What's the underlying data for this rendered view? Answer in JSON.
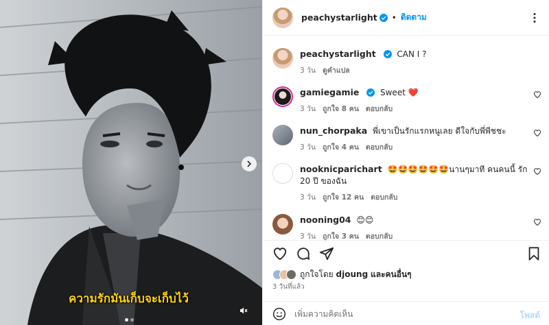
{
  "post": {
    "overlay_caption": "ความรักมันเก็บจะเก็บไว้",
    "carousel_dots": 2
  },
  "header": {
    "username": "peachystarlight",
    "separator": "•",
    "follow_label": "ติดตาม"
  },
  "caption": {
    "username": "peachystarlight",
    "text": "CAN I ?",
    "time": "3 วัน",
    "translate_label": "ดูคำแปล"
  },
  "comments": [
    {
      "username": "gamiegamie",
      "verified": true,
      "text": "Sweet ❤️",
      "time": "3 วัน",
      "likes": "ถูกใจ 8 คน",
      "reply": "ตอบกลับ"
    },
    {
      "username": "nun_chorpaka",
      "verified": false,
      "text": "พี่เขาเป็นรักแรกหนูเลย ดีใจกับพี่พีชชะ",
      "time": "3 วัน",
      "likes": "ถูกใจ 4 คน",
      "reply": "ตอบกลับ"
    },
    {
      "username": "nooknicparichart",
      "verified": false,
      "text": "🤩🤩🤩🤩🤩🤩นานๆมาที คนคนนี้ รัก 20 ปี ของฉัน",
      "time": "3 วัน",
      "likes": "ถูกใจ 12 คน",
      "reply": "ตอบกลับ"
    },
    {
      "username": "nooning04",
      "verified": false,
      "text": "😊😊",
      "time": "3 วัน",
      "likes": "ถูกใจ 3 คน",
      "reply": "ตอบกลับ"
    }
  ],
  "likes": {
    "prefix": "ถูกใจโดย",
    "user": "djoung",
    "suffix": "และคนอื่นๆ"
  },
  "timestamp": "3 วันที่แล้ว",
  "add_comment": {
    "placeholder": "เพิ่มความคิดเห็น",
    "post_label": "โพสต์"
  },
  "colors": {
    "accent": "#0095f6",
    "verified": "#0095f6",
    "overlay_text": "#ffd400",
    "heart_red": "#ed4956"
  },
  "icons": [
    "more-icon",
    "verified-icon",
    "heart-icon",
    "comment-icon",
    "share-icon",
    "save-icon",
    "emoji-icon",
    "mute-icon",
    "chevron-right-icon"
  ]
}
